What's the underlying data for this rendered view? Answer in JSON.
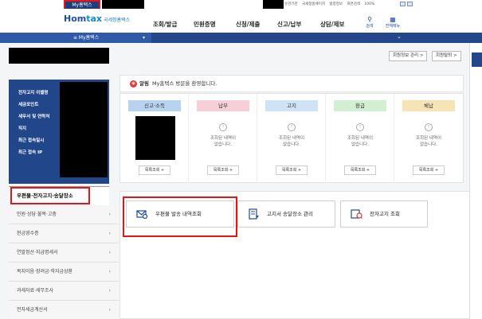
{
  "top": {
    "my_tab": "My홈택스",
    "util_links": [
      "유관기관",
      "국세청홈페이지",
      "법령정보",
      "화면검색",
      "100%"
    ]
  },
  "header": {
    "logo_main": "Hom",
    "logo_tax": "tax",
    "logo_sub": "국세청홈택스",
    "nav": [
      "조회/발급",
      "민원증명",
      "신청/제출",
      "신고/납부",
      "상담/제보"
    ],
    "search_label": "검색",
    "allmenu_label": "전체메뉴"
  },
  "bluebar": {
    "menu_label": "≡  My홈택스"
  },
  "account_buttons": {
    "info": "회원정보 관리 >",
    "logout": "회원탈퇴 >"
  },
  "user_panel": {
    "rows": [
      "전자고지 이벨명",
      "세금포인트",
      "세무서 및 연락처",
      "직지",
      "최근 접속일시",
      "최근 접속 IP"
    ]
  },
  "notice": {
    "tag": "알림",
    "text": "My홈택스 방문을 환영합니다."
  },
  "cards": [
    {
      "title": "신고·소득",
      "color": "#b7d3f0",
      "message": "",
      "button": "목록조회 +"
    },
    {
      "title": "납부",
      "color": "#f7cfd6",
      "message": "조회된 내역이\n없습니다.",
      "button": "목록조회 +"
    },
    {
      "title": "고지",
      "color": "#cfe3f6",
      "message": "조회된 내역이\n없습니다.",
      "button": "목록조회 +"
    },
    {
      "title": "환급",
      "color": "#d2efd2",
      "message": "조회된 내역이\n없습니다.",
      "button": "목록조회 +"
    },
    {
      "title": "체납",
      "color": "#f6e3b6",
      "message": "조회된 내역이\n없습니다.",
      "button": "목록조회 +"
    }
  ],
  "left_menu": {
    "section_title": "우편물·전자고지·송달장소",
    "items": [
      "민원·상담·불복·고충",
      "현금영수증",
      "연말정산·지급명세서",
      "복지이음·장려금·학자금상환",
      "과세자료·세무조사",
      "전자세금계산서"
    ]
  },
  "services": [
    "우편물 발송 내역조회",
    "고지서 송달장소 관리",
    "전자고지 조회"
  ],
  "colors": {
    "brand_blue": "#24468a",
    "highlight_red": "#e3161a"
  }
}
